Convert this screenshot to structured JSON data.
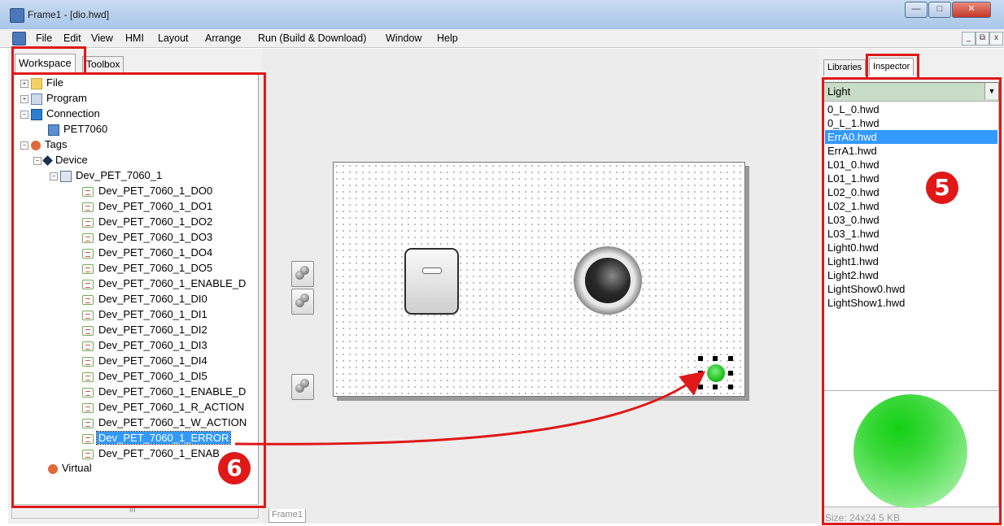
{
  "window": {
    "title": "Frame1 - [dio.hwd]",
    "controls": [
      "minimize-icon",
      "maximize-icon",
      "close-icon"
    ]
  },
  "menu": [
    "File",
    "Edit",
    "View",
    "HMI",
    "Layout",
    "Arrange",
    "Run (Build & Download)",
    "Window",
    "Help"
  ],
  "left_panel": {
    "tabs": [
      "Workspace",
      "Toolbox"
    ],
    "active_tab": "Workspace",
    "tree": {
      "file": "File",
      "program": "Program",
      "connection": "Connection",
      "connection_child": "PET7060",
      "tags": "Tags",
      "device": "Device",
      "device_child": "Dev_PET_7060_1",
      "tag_items": [
        "Dev_PET_7060_1_DO0",
        "Dev_PET_7060_1_DO1",
        "Dev_PET_7060_1_DO2",
        "Dev_PET_7060_1_DO3",
        "Dev_PET_7060_1_DO4",
        "Dev_PET_7060_1_DO5",
        "Dev_PET_7060_1_ENABLE_D",
        "Dev_PET_7060_1_DI0",
        "Dev_PET_7060_1_DI1",
        "Dev_PET_7060_1_DI2",
        "Dev_PET_7060_1_DI3",
        "Dev_PET_7060_1_DI4",
        "Dev_PET_7060_1_DI5",
        "Dev_PET_7060_1_ENABLE_D",
        "Dev_PET_7060_1_R_ACTION",
        "Dev_PET_7060_1_W_ACTION",
        "Dev_PET_7060_1_ERROR",
        "Dev_PET_7060_1_ENAB"
      ],
      "selected_item": "Dev_PET_7060_1_ERROR",
      "virtual": "Virtual"
    },
    "scroll_marker": "III"
  },
  "canvas": {
    "frame_tab": "Frame1",
    "widgets": [
      "switch",
      "knob-light",
      "green-led"
    ]
  },
  "right_panel": {
    "tabs": [
      "Libraries",
      "Inspector"
    ],
    "active_tab": "Inspector",
    "dropdown_value": "Light",
    "files": [
      "0_L_0.hwd",
      "0_L_1.hwd",
      "ErrA0.hwd",
      "ErrA1.hwd",
      "L01_0.hwd",
      "L01_1.hwd",
      "L02_0.hwd",
      "L02_1.hwd",
      "L03_0.hwd",
      "L03_1.hwd",
      "Light0.hwd",
      "Light1.hwd",
      "Light2.hwd",
      "LightShow0.hwd",
      "LightShow1.hwd"
    ],
    "selected_file": "ErrA0.hwd",
    "size_text": "Size: 24x24 5 KB"
  },
  "annotations": {
    "badge_5": "5",
    "badge_6": "6",
    "color": "#e01818"
  }
}
